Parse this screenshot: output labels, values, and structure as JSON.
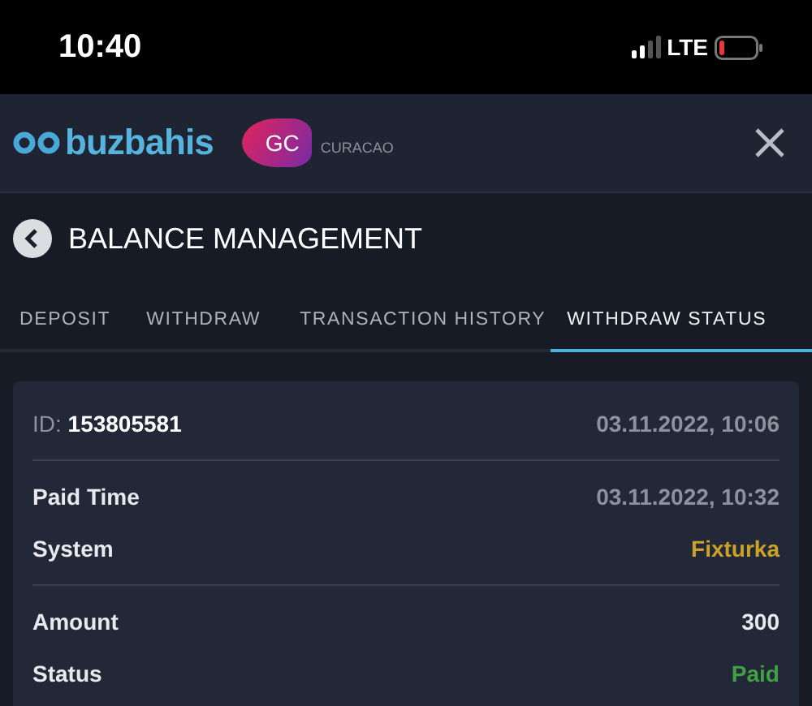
{
  "status_bar": {
    "time": "10:40",
    "network": "LTE"
  },
  "header": {
    "brand": "buzbahis",
    "partner_mark": "GC",
    "partner_name": "CURACAO"
  },
  "title": "BALANCE MANAGEMENT",
  "tabs": [
    {
      "label": "DEPOSIT",
      "selected": false
    },
    {
      "label": "WITHDRAW",
      "selected": false
    },
    {
      "label": "TRANSACTION HISTORY",
      "selected": false
    },
    {
      "label": "WITHDRAW STATUS",
      "selected": true
    }
  ],
  "card": {
    "id_label": "ID:",
    "id": "153805581",
    "date": "03.11.2022, 10:06",
    "groups": [
      [
        {
          "label": "Paid Time",
          "value": "03.11.2022, 10:32",
          "color": "#8d919c"
        },
        {
          "label": "System",
          "value": "Fixturka",
          "color": "#c9a227"
        }
      ],
      [
        {
          "label": "Amount",
          "value": "300",
          "color": "#e8e9ec"
        },
        {
          "label": "Status",
          "value": "Paid",
          "color": "#3fa142"
        }
      ]
    ]
  }
}
